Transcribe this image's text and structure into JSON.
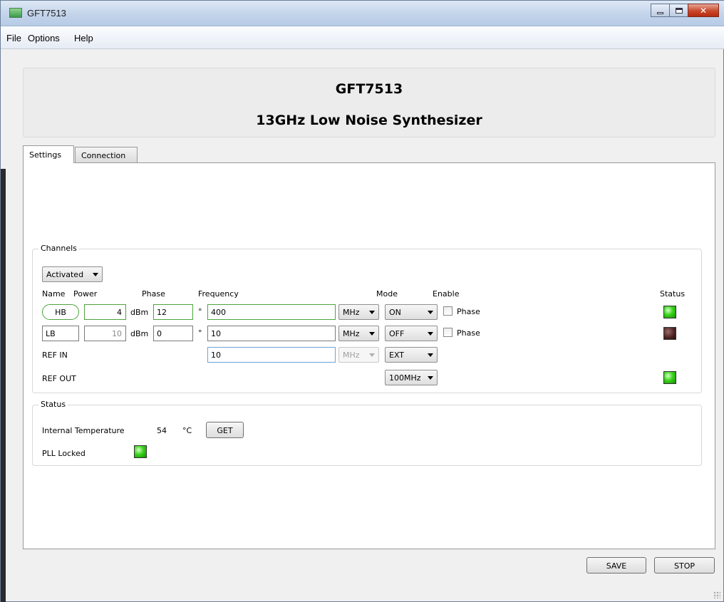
{
  "window": {
    "title": "GFT7513"
  },
  "menu": [
    "File",
    "Options",
    "Help"
  ],
  "header": {
    "title": "GFT7513",
    "subtitle": "13GHz Low Noise Synthesizer"
  },
  "tabs": {
    "settings": "Settings",
    "connection": "Connection"
  },
  "channels": {
    "title": "Channels",
    "filter": "Activated",
    "columns": {
      "name": "Name",
      "power": "Power",
      "phase": "Phase",
      "frequency": "Frequency",
      "mode": "Mode",
      "enable": "Enable",
      "status": "Status"
    },
    "rows": [
      {
        "name": "HB",
        "power": "4",
        "power_unit": "dBm",
        "phase": "12",
        "phase_unit": "°",
        "frequency": "400",
        "freq_unit": "MHz",
        "mode": "ON",
        "enable_label": "Phase",
        "enable_checked": false,
        "status": "on"
      },
      {
        "name": "LB",
        "power": "10",
        "power_unit": "dBm",
        "phase": "0",
        "phase_unit": "°",
        "frequency": "10",
        "freq_unit": "MHz",
        "mode": "OFF",
        "enable_label": "Phase",
        "enable_checked": false,
        "status": "off"
      }
    ],
    "ref_in": {
      "label": "REF IN",
      "frequency": "10",
      "freq_unit": "MHz",
      "mode": "EXT"
    },
    "ref_out": {
      "label": "REF OUT",
      "mode": "100MHz",
      "status": "on"
    }
  },
  "status": {
    "title": "Status",
    "temperature_label": "Internal Temperature",
    "temperature_value": "54",
    "temperature_unit": "°C",
    "get_button": "GET",
    "pll_label": "PLL Locked",
    "pll_status": "on"
  },
  "footer": {
    "save": "SAVE",
    "stop": "STOP"
  },
  "colors": {
    "led_on": "#39d41a",
    "led_off": "#4a2222",
    "field_active_border": "#4fa23f"
  }
}
